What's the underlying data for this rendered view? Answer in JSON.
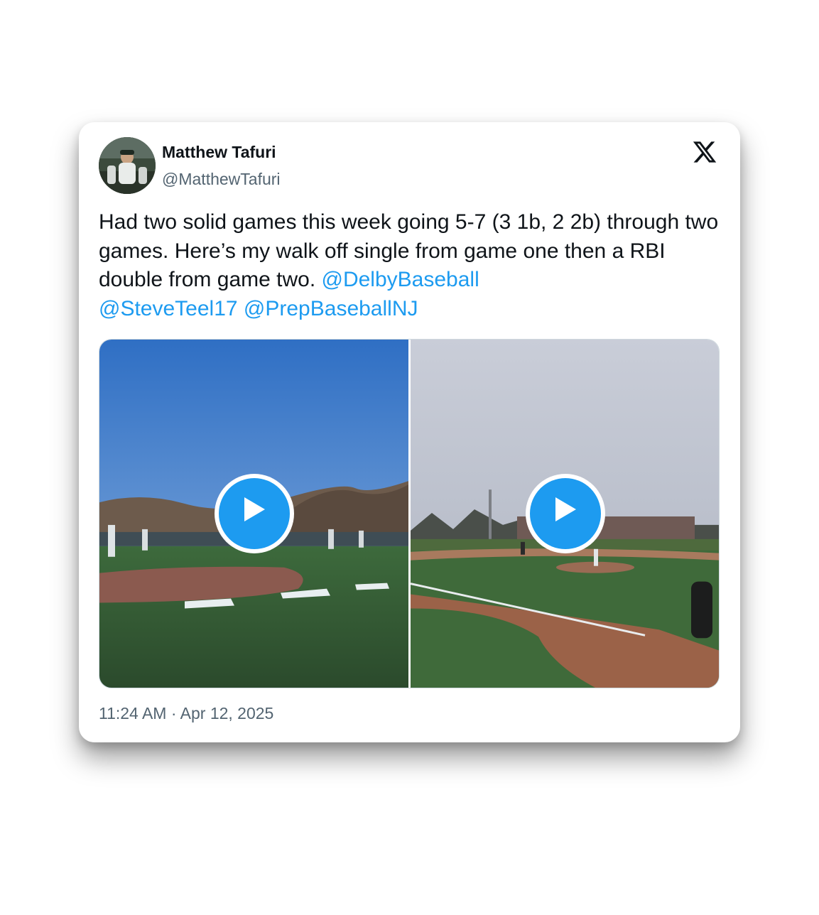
{
  "author": {
    "name": "Matthew Tafuri",
    "handle": "@MatthewTafuri"
  },
  "icons": {
    "brand": "x-logo-icon",
    "play": "play-icon"
  },
  "tweet": {
    "text": "Had two solid games this week going 5-7 (3 1b, 2 2b) through two games. Here’s my walk off single from game one then a RBI double from game two. ",
    "mentions": [
      "@DelbyBaseball",
      "@SteveTeel17",
      "@PrepBaseballNJ"
    ]
  },
  "timestamp": "11:24 AM · Apr 12, 2025",
  "colors": {
    "accent": "#1d9bf0",
    "text": "#0f1419",
    "secondary": "#536471"
  }
}
